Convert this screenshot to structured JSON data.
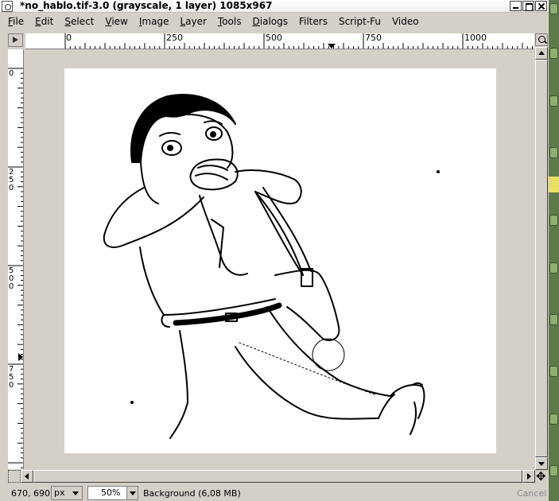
{
  "window": {
    "title": "*no_hablo.tif-3.0 (grayscale, 1 layer) 1085x967"
  },
  "menu": {
    "items": [
      {
        "mnemonic": "F",
        "rest": "ile"
      },
      {
        "mnemonic": "E",
        "rest": "dit"
      },
      {
        "mnemonic": "S",
        "rest": "elect"
      },
      {
        "mnemonic": "V",
        "rest": "iew"
      },
      {
        "mnemonic": "I",
        "rest": "mage"
      },
      {
        "mnemonic": "L",
        "rest": "ayer"
      },
      {
        "mnemonic": "T",
        "rest": "ools"
      },
      {
        "mnemonic": "D",
        "rest": "ialogs"
      },
      {
        "mnemonic": "",
        "rest": "Filters"
      },
      {
        "mnemonic": "",
        "rest": "Script-Fu"
      },
      {
        "mnemonic": "",
        "rest": "Video"
      }
    ]
  },
  "rulers": {
    "horizontal": [
      "0",
      "250",
      "500",
      "750",
      "1000"
    ],
    "vertical": [
      "0",
      "250",
      "500",
      "750"
    ]
  },
  "status": {
    "coords": "670, 690",
    "unit": "px",
    "zoom": "50%",
    "message": "Background (6,08 MB)",
    "cancel_label": "Cancel"
  },
  "colors": {
    "chrome": "#d4d0c8",
    "canvas": "#ffffff"
  }
}
